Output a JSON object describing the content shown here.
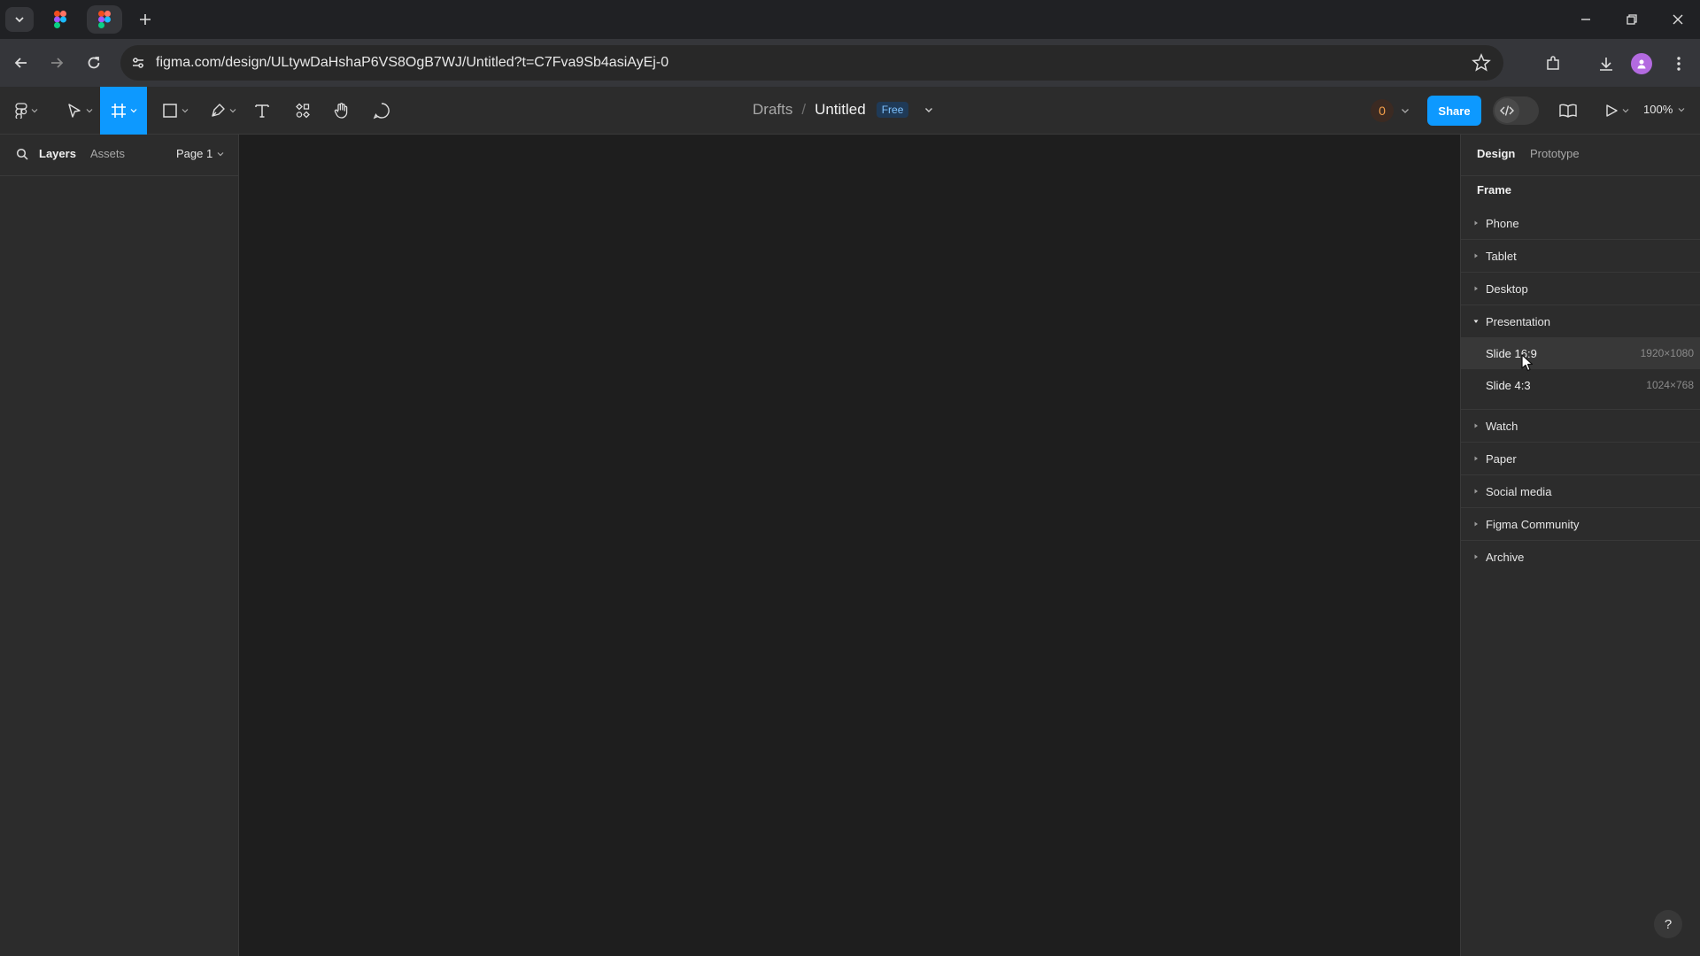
{
  "browser": {
    "url": "figma.com/design/ULtywDaHshaP6VS8OgB7WJ/Untitled?t=C7Fva9Sb4asiAyEj-0",
    "new_tab_icon": "plus-icon"
  },
  "toolbar": {
    "breadcrumb_drafts": "Drafts",
    "breadcrumb_sep": "/",
    "file_title": "Untitled",
    "plan_badge": "Free",
    "collaborator_count": "0",
    "share_label": "Share",
    "zoom": "100%"
  },
  "left_panel": {
    "tab_layers": "Layers",
    "tab_assets": "Assets",
    "page": "Page 1"
  },
  "right_panel": {
    "tab_design": "Design",
    "tab_prototype": "Prototype",
    "heading": "Frame",
    "categories_top": [
      "Phone",
      "Tablet",
      "Desktop"
    ],
    "open_category": "Presentation",
    "presets": [
      {
        "label": "Slide 16:9",
        "size": "1920×1080"
      },
      {
        "label": "Slide 4:3",
        "size": "1024×768"
      }
    ],
    "categories_bottom": [
      "Watch",
      "Paper",
      "Social media",
      "Figma Community",
      "Archive"
    ]
  },
  "help_label": "?",
  "colors": {
    "accent": "#0d99ff",
    "panel": "#2c2c2c",
    "canvas": "#1e1e1e"
  }
}
